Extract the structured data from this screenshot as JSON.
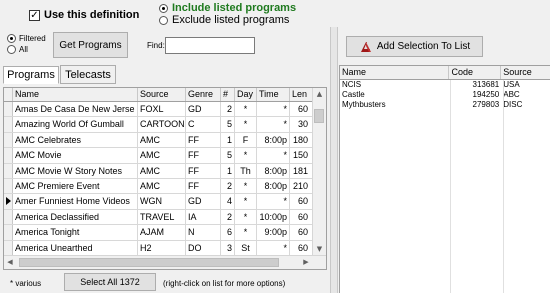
{
  "header": {
    "use_definition_label": "Use this definition",
    "use_definition_checked": true,
    "include_label": "Include listed programs",
    "exclude_label": "Exclude listed programs",
    "include_selected": true
  },
  "filter": {
    "filtered_label": "Filtered",
    "all_label": "All",
    "filtered_selected": true,
    "get_programs_label": "Get Programs",
    "find_label": "Find:",
    "find_value": ""
  },
  "tabs": [
    {
      "label": "Programs",
      "active": true
    },
    {
      "label": "Telecasts",
      "active": false
    }
  ],
  "programs_grid": {
    "columns": [
      "Name",
      "Source",
      "Genre",
      "#",
      "Day",
      "Time",
      "Len"
    ],
    "rows": [
      {
        "name": "Amas De Casa De New Jerse",
        "source": "FOXL",
        "genre": "GD",
        "num": "2",
        "day": "*",
        "time": "*",
        "len": "60",
        "current": false
      },
      {
        "name": "Amazing World Of Gumball",
        "source": "CARTOON",
        "genre": "C",
        "num": "5",
        "day": "*",
        "time": "*",
        "len": "30",
        "current": false
      },
      {
        "name": "AMC Celebrates",
        "source": "AMC",
        "genre": "FF",
        "num": "1",
        "day": "F",
        "time": "8:00p",
        "len": "180",
        "current": false
      },
      {
        "name": "AMC Movie",
        "source": "AMC",
        "genre": "FF",
        "num": "5",
        "day": "*",
        "time": "*",
        "len": "150",
        "current": false
      },
      {
        "name": "AMC Movie W Story Notes",
        "source": "AMC",
        "genre": "FF",
        "num": "1",
        "day": "Th",
        "time": "8:00p",
        "len": "181",
        "current": false
      },
      {
        "name": "AMC Premiere Event",
        "source": "AMC",
        "genre": "FF",
        "num": "2",
        "day": "*",
        "time": "8:00p",
        "len": "210",
        "current": false
      },
      {
        "name": "Amer Funniest Home Videos",
        "source": "WGN",
        "genre": "GD",
        "num": "4",
        "day": "*",
        "time": "*",
        "len": "60",
        "current": true
      },
      {
        "name": "America Declassified",
        "source": "TRAVEL",
        "genre": "IA",
        "num": "2",
        "day": "*",
        "time": "10:00p",
        "len": "60",
        "current": false
      },
      {
        "name": "America Tonight",
        "source": "AJAM",
        "genre": "N",
        "num": "6",
        "day": "*",
        "time": "9:00p",
        "len": "60",
        "current": false
      },
      {
        "name": "America Unearthed",
        "source": "H2",
        "genre": "DO",
        "num": "3",
        "day": "St",
        "time": "*",
        "len": "60",
        "current": false
      }
    ]
  },
  "footer": {
    "various_label": "* various",
    "select_all_label": "Select All 1372",
    "hint_label": "(right-click on list for more options)"
  },
  "right_panel": {
    "add_selection_label": "Add Selection To List",
    "columns": [
      "Name",
      "Code",
      "Source"
    ],
    "rows": [
      {
        "name": "NCIS",
        "code": "313681",
        "source": "USA"
      },
      {
        "name": "Castle",
        "code": "194250",
        "source": "ABC"
      },
      {
        "name": "Mythbusters",
        "code": "279803",
        "source": "DISC"
      }
    ]
  },
  "colors": {
    "include_text": "#1f7a1f",
    "add_icon": "#a01818"
  },
  "icons": {
    "add_selection": "add-icon"
  }
}
